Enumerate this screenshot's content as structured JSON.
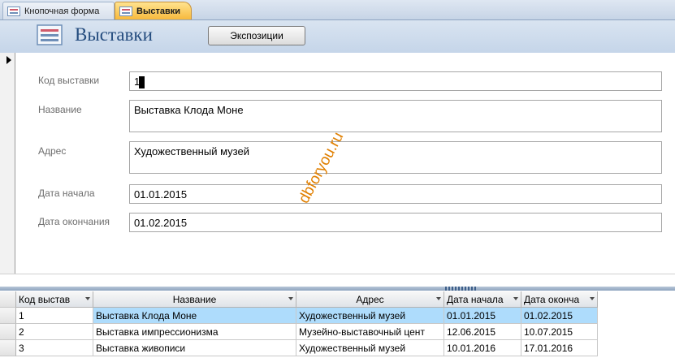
{
  "tabs": [
    {
      "label": "Кнопочная форма",
      "active": false
    },
    {
      "label": "Выставки",
      "active": true
    }
  ],
  "header": {
    "title": "Выставки",
    "button_label": "Экспозиции"
  },
  "fields": {
    "id": {
      "label": "Код выставки",
      "value": "1"
    },
    "name": {
      "label": "Название",
      "value": "Выставка Клода Моне"
    },
    "address": {
      "label": "Адрес",
      "value": "Художественный музей"
    },
    "start": {
      "label": "Дата начала",
      "value": "01.01.2015"
    },
    "end": {
      "label": "Дата окончания",
      "value": "01.02.2015"
    }
  },
  "watermark": "dbforyou.ru",
  "datasheet": {
    "columns": [
      "Код выстав",
      "Название",
      "Адрес",
      "Дата начала",
      "Дата оконча"
    ],
    "rows": [
      [
        "1",
        "Выставка Клода Моне",
        "Художественный музей",
        "01.01.2015",
        "01.02.2015"
      ],
      [
        "2",
        "Выставка импрессионизма",
        "Музейно-выставочный цент",
        "12.06.2015",
        "10.07.2015"
      ],
      [
        "3",
        "Выставка живописи",
        "Художественный музей",
        "10.01.2016",
        "17.01.2016"
      ]
    ],
    "selected_row": 0
  },
  "colors": {
    "title": "#244c7e",
    "active_tab": "#f7b93c",
    "selected_row": "#aedcfc",
    "watermark": "#e07f00"
  }
}
